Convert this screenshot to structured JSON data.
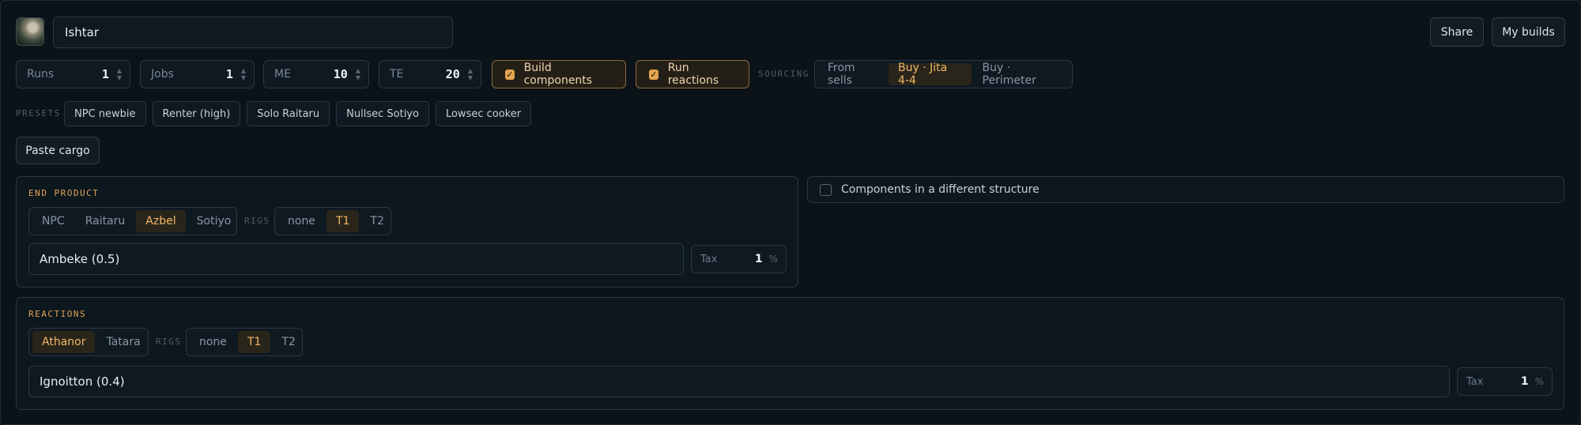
{
  "header": {
    "build_name": "Ishtar",
    "share_label": "Share",
    "my_builds_label": "My builds"
  },
  "controls": {
    "runs": {
      "label": "Runs",
      "value": "1"
    },
    "jobs": {
      "label": "Jobs",
      "value": "1"
    },
    "me": {
      "label": "ME",
      "value": "10"
    },
    "te": {
      "label": "TE",
      "value": "20"
    },
    "build_components": "Build components",
    "run_reactions": "Run reactions",
    "sourcing_label": "SOURCING",
    "sourcing_options": [
      "From sells",
      "Buy · Jita 4-4",
      "Buy · Perimeter"
    ],
    "sourcing_selected": "Buy · Jita 4-4"
  },
  "presets": {
    "label": "PRESETS",
    "items": [
      "NPC newbie",
      "Renter (high)",
      "Solo Raitaru",
      "Nullsec Sotiyo",
      "Lowsec cooker"
    ]
  },
  "paste_cargo_label": "Paste cargo",
  "end_product": {
    "title": "END PRODUCT",
    "structures": [
      "NPC",
      "Raitaru",
      "Azbel",
      "Sotiyo"
    ],
    "structure_selected": "Azbel",
    "rigs_label": "RIGS",
    "rigs": [
      "none",
      "T1",
      "T2"
    ],
    "rig_selected": "T1",
    "system": "Ambeke (0.5)",
    "tax_label": "Tax",
    "tax_value": "1",
    "tax_unit": "%"
  },
  "components_structure": {
    "label": "Components in a different structure",
    "checked": false
  },
  "reactions": {
    "title": "REACTIONS",
    "structures": [
      "Athanor",
      "Tatara"
    ],
    "structure_selected": "Athanor",
    "rigs_label": "RIGS",
    "rigs": [
      "none",
      "T1",
      "T2"
    ],
    "rig_selected": "T1",
    "system": "Ignoitton (0.4)",
    "tax_label": "Tax",
    "tax_value": "1",
    "tax_unit": "%"
  },
  "colors": {
    "accent": "#e0a456",
    "background": "#0b1319",
    "border": "#2a3843"
  }
}
